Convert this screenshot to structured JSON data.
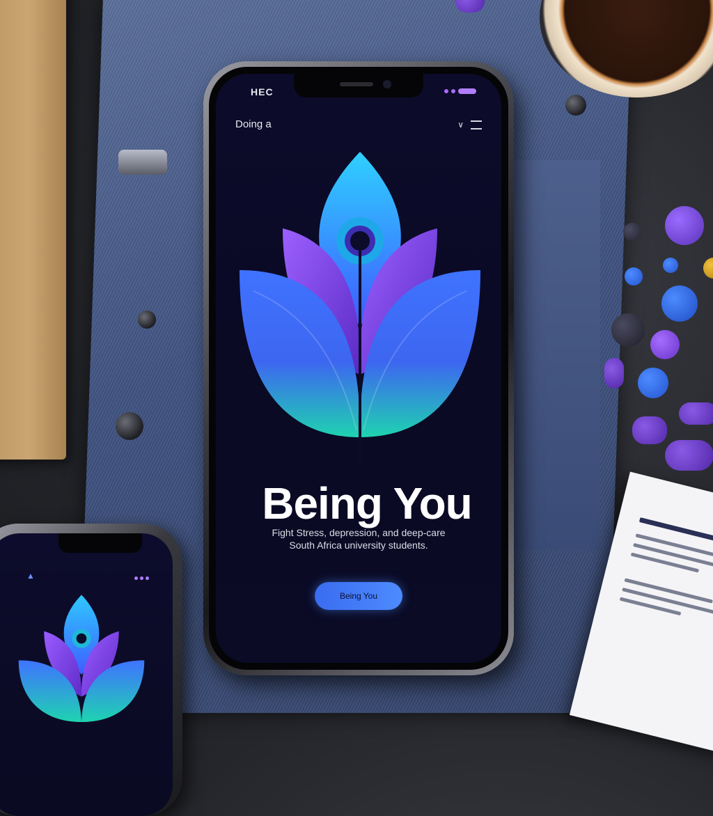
{
  "status_bar": {
    "carrier": "HEC"
  },
  "header": {
    "app_label": "Doing a",
    "menu_glyph": "∨"
  },
  "hero": {
    "title": "Being You",
    "subtitle_line1": "Fight Stress, depression, and deep-care",
    "subtitle_line2": "South Africa university students."
  },
  "cta": {
    "label": "Being You"
  },
  "icons": [
    "leaf-logo-icon",
    "menu-icon",
    "person-icon"
  ],
  "colors": {
    "screen_bg": "#0b0b26",
    "leaf_blue": "#3f73ff",
    "leaf_purple": "#7b3fe0",
    "leaf_teal": "#1fd3b0",
    "cta_bg": "#4d8bff"
  }
}
